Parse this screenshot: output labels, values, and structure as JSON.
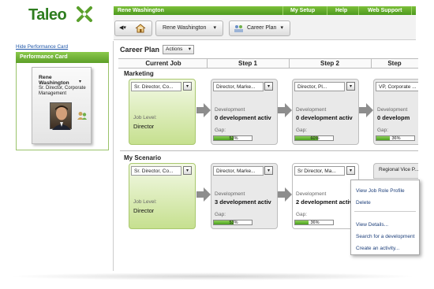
{
  "brand": {
    "logo_text": "Taleo",
    "accent": "#5aa02c"
  },
  "topbar": {
    "user_name": "Rene Washington",
    "links": [
      "My Setup",
      "Help",
      "Web Support"
    ]
  },
  "nav": {
    "back_icon": "back-arrow-icon",
    "home_icon": "home-icon",
    "user_dropdown": "Rene Washington",
    "career_plan_button": "Career Plan"
  },
  "left_panel": {
    "hide_link": "Hide Performance Card",
    "card_title": "Performance Card",
    "person_name_line1": "Rene",
    "person_name_line2": "Washington",
    "person_title": "Sr. Director, Corporate Management"
  },
  "career_plan": {
    "title": "Career Plan",
    "actions_label": "Actions",
    "columns": [
      "Current Job",
      "Step 1",
      "Step 2",
      "Step"
    ]
  },
  "sections": [
    {
      "name": "Marketing",
      "current": {
        "title": "Sr. Director, Co...",
        "job_level_label": "Job Level:",
        "job_level": "Director"
      },
      "steps": [
        {
          "title": "Director, Marke...",
          "dev_label": "Development",
          "dev_value": "0 development activ",
          "gap_label": "Gap:",
          "gap_pct": "53%",
          "gap": 0.53
        },
        {
          "title": "Director, Pl...",
          "dev_label": "Development",
          "dev_value": "0 development activ",
          "gap_label": "Gap:",
          "gap_pct": "60%",
          "gap": 0.6
        },
        {
          "title": "VP, Corporate ...",
          "dev_label": "Development",
          "dev_value": "0 developm",
          "gap_label": "Gap:",
          "gap_pct": "36%",
          "gap": 0.36
        }
      ]
    },
    {
      "name": "My Scenario",
      "current": {
        "title": "Sr. Director, Co...",
        "job_level_label": "Job Level:",
        "job_level": "Director"
      },
      "steps": [
        {
          "title": "Director, Marke...",
          "dev_label": "Development",
          "dev_value": "3 development activ",
          "gap_label": "Gap:",
          "gap_pct": "53%",
          "gap": 0.53
        },
        {
          "title": "Sr Director, Ma...",
          "dev_label": "Development",
          "dev_value": "2 development activ",
          "gap_label": "Gap:",
          "gap_pct": "36%",
          "gap": 0.36
        },
        {
          "title": "Regional Vice P..."
        }
      ]
    }
  ],
  "context_menu": {
    "items": [
      "View Job Role Profile",
      "Delete",
      "View Details...",
      "Search for a development",
      "Create an activity..."
    ]
  }
}
